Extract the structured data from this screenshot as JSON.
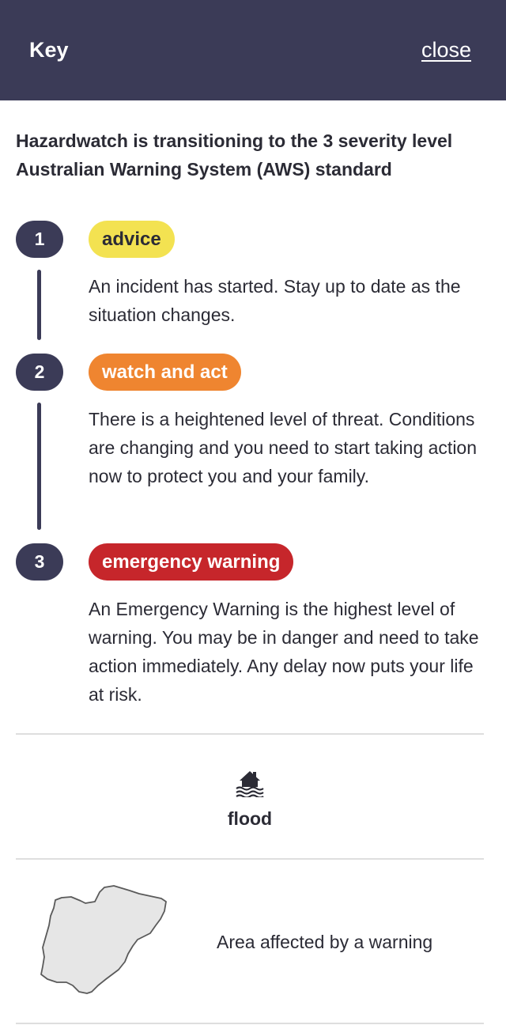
{
  "header": {
    "title": "Key",
    "close_label": "close"
  },
  "intro": "Hazardwatch is transitioning to the 3 severity level Australian Warning System (AWS) standard",
  "levels": [
    {
      "number": "1",
      "label": "advice",
      "color": "#f3e251",
      "description": "An incident has started. Stay up to date as the situation changes."
    },
    {
      "number": "2",
      "label": "watch and act",
      "color": "#ef8530",
      "description": "There is a heightened level of threat. Conditions are changing and you need to start taking action now to protect you and your family."
    },
    {
      "number": "3",
      "label": "emergency warning",
      "color": "#c6262b",
      "description": "An Emergency Warning is the highest level of warning. You may be in danger and need to take action immediately. Any delay now puts your life at risk."
    }
  ],
  "hazard": {
    "icon": "flood-icon",
    "label": "flood"
  },
  "area": {
    "icon": "area-polygon-icon",
    "label": "Area affected by a warning"
  },
  "colors": {
    "header_bg": "#3b3b57",
    "badge_bg": "#3b3b57",
    "divider": "#dedede",
    "area_fill": "#e6e6e6",
    "area_stroke": "#5a5a5a"
  }
}
